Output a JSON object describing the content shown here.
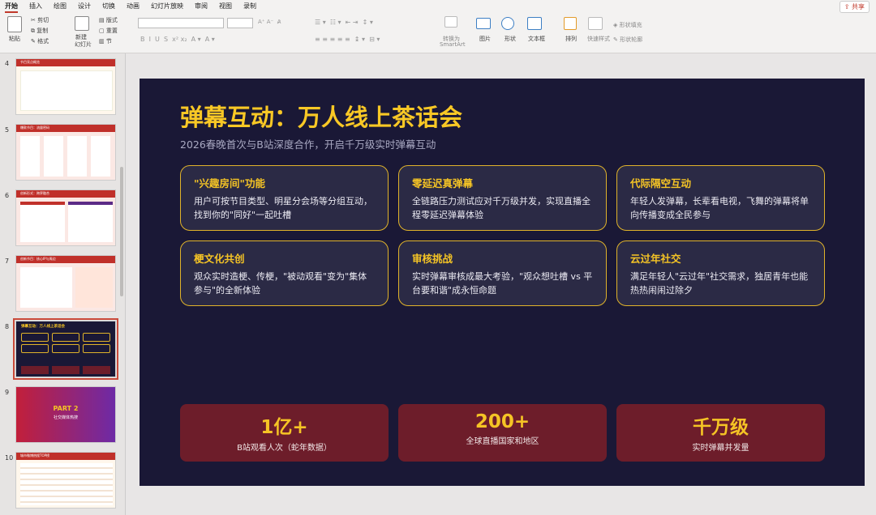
{
  "ribbon": {
    "tabs": [
      "开始",
      "插入",
      "绘图",
      "设计",
      "切换",
      "动画",
      "幻灯片放映",
      "审阅",
      "视图",
      "录制"
    ],
    "active_tab": "开始",
    "share": "共享",
    "paste": "粘贴",
    "cut": "剪切",
    "copy": "复制",
    "format": "格式",
    "new_slide": "新建",
    "new_slide2": "幻灯片",
    "layout": "版式",
    "reset": "重置",
    "section": "节",
    "smartart": "转换为",
    "smartart2": "SmartArt",
    "picture": "图片",
    "shape": "形状",
    "textbox": "文本框",
    "arrange": "排列",
    "quick_style": "快速样式",
    "shape_fill": "形状填充",
    "shape_outline": "形状轮廓"
  },
  "thumbnails": [
    {
      "num": "4",
      "title": "节目亮点概览"
    },
    {
      "num": "5",
      "title": "爆款节目：流量密码"
    },
    {
      "num": "6",
      "title": "创新形式：跨界融合"
    },
    {
      "num": "7",
      "title": "创新节目：核心IP与周边"
    },
    {
      "num": "8",
      "title": "弹幕互动：万人线上茶话会"
    },
    {
      "num": "9",
      "title": "PART 2",
      "subtitle": "社交媒体热搜"
    },
    {
      "num": "10",
      "title": "城市微博热搜TOP榜"
    }
  ],
  "slide": {
    "title": "弹幕互动：万人线上茶话会",
    "subtitle": "2026春晚首次与B站深度合作，开启千万级实时弹幕互动",
    "cards": [
      {
        "title": "\"兴趣房间\"功能",
        "desc": "用户可按节目类型、明星分会场等分组互动，找到你的\"同好\"一起吐槽"
      },
      {
        "title": "零延迟真弹幕",
        "desc": "全链路压力测试应对千万级并发，实现直播全程零延迟弹幕体验"
      },
      {
        "title": "代际隔空互动",
        "desc": "年轻人发弹幕，长辈看电视，飞舞的弹幕将单向传播变成全民参与"
      },
      {
        "title": "梗文化共创",
        "desc": "观众实时造梗、传梗，\"被动观看\"变为\"集体参与\"的全新体验"
      },
      {
        "title": "审核挑战",
        "desc": "实时弹幕审核成最大考验，\"观众想吐槽 vs 平台要和谐\"成永恒命题"
      },
      {
        "title": "云过年社交",
        "desc": "满足年轻人\"云过年\"社交需求，独居青年也能热热闹闹过除夕"
      }
    ],
    "stats": [
      {
        "value": "1亿+",
        "label": "B站观看人次（蛇年数据）"
      },
      {
        "value": "200+",
        "label": "全球直播国家和地区"
      },
      {
        "value": "千万级",
        "label": "实时弹幕并发量"
      }
    ]
  },
  "colors": {
    "slide_bg": "#1a1836",
    "accent": "#f5c425",
    "stat_bg": "#6d1d2a",
    "brand_red": "#c0302a"
  }
}
